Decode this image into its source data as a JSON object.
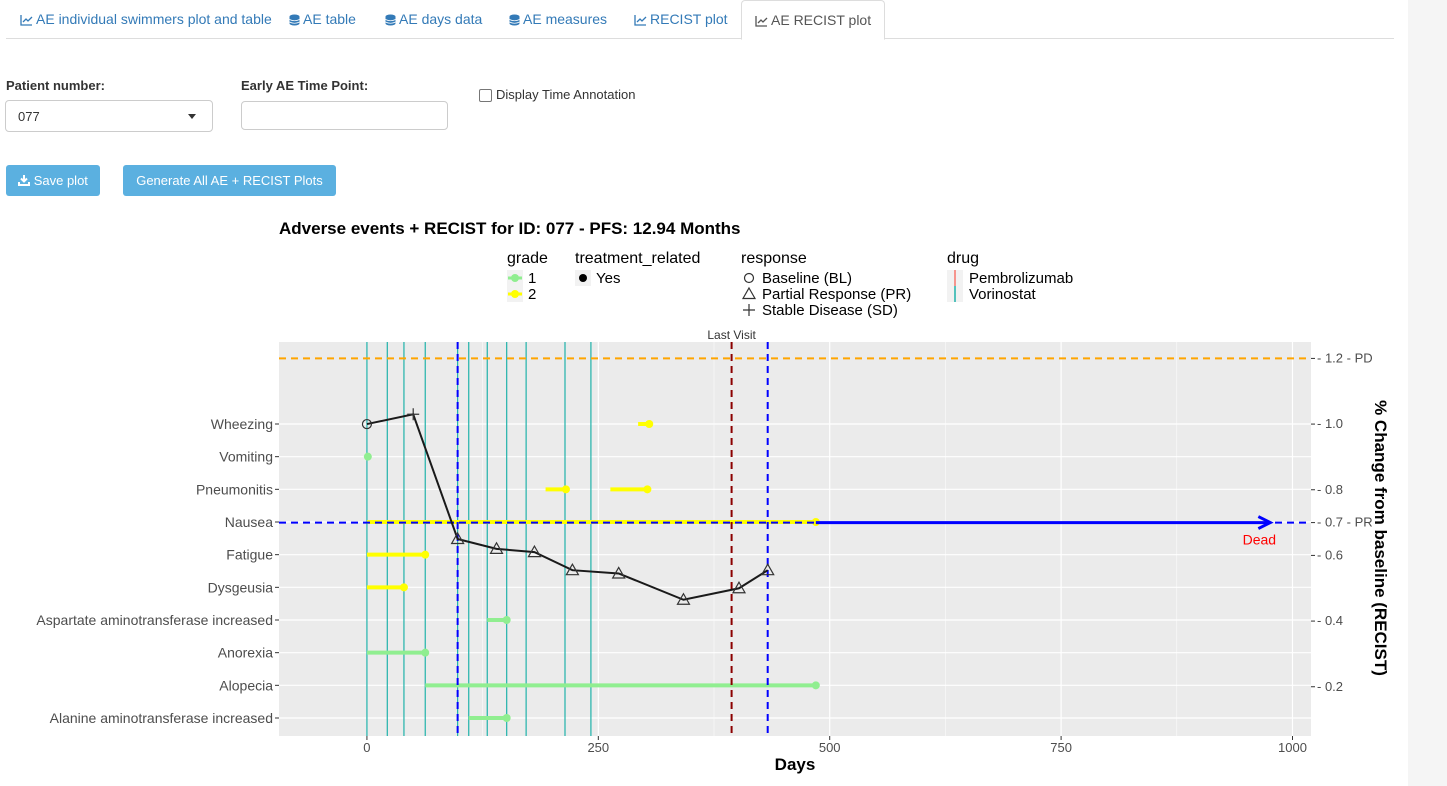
{
  "tabs": [
    {
      "label": "AE individual swimmers plot and table",
      "icon": "line-chart-icon"
    },
    {
      "label": "AE table",
      "icon": "database-icon"
    },
    {
      "label": "AE days data",
      "icon": "database-icon"
    },
    {
      "label": "AE measures",
      "icon": "database-icon"
    },
    {
      "label": "RECIST plot",
      "icon": "line-chart-icon"
    },
    {
      "label": "AE RECIST plot",
      "icon": "line-chart-icon",
      "active": true
    }
  ],
  "controls": {
    "patient_label": "Patient number:",
    "patient_value": "077",
    "early_ae_label": "Early AE Time Point:",
    "early_ae_value": "",
    "display_time_annotation_label": "Display Time Annotation",
    "display_time_annotation_checked": false,
    "save_plot_label": "Save plot",
    "generate_all_label": "Generate All AE + RECIST Plots"
  },
  "chart_data": {
    "type": "line",
    "title": "Adverse events + RECIST for ID: 077 - PFS: 12.94 Months",
    "xlabel": "Days",
    "ylabel_right": "% Change from baseline (RECIST)",
    "xlim": [
      -95,
      1020
    ],
    "x_ticks": [
      0,
      250,
      500,
      750,
      1000
    ],
    "ylim_right": [
      0.05,
      1.25
    ],
    "y_right_ticks": [
      {
        "value": 0.2,
        "label": "0.2"
      },
      {
        "value": 0.4,
        "label": "0.4"
      },
      {
        "value": 0.6,
        "label": "0.6"
      },
      {
        "value": 0.7,
        "label": "0.7 - PR"
      },
      {
        "value": 0.8,
        "label": "0.8"
      },
      {
        "value": 1.0,
        "label": "1.0"
      },
      {
        "value": 1.2,
        "label": "1.2 - PD"
      }
    ],
    "ae_categories": [
      "Wheezing",
      "Vomiting",
      "Pneumonitis",
      "Nausea",
      "Fatigue",
      "Dysgeusia",
      "Aspartate aminotransferase increased",
      "Anorexia",
      "Alopecia",
      "Alanine aminotransferase increased"
    ],
    "ae_segments": [
      {
        "ae": "Wheezing",
        "start": 293,
        "end": 305,
        "grade": 2
      },
      {
        "ae": "Vomiting",
        "start": 0,
        "end": 1,
        "grade": 1
      },
      {
        "ae": "Pneumonitis",
        "start": 193,
        "end": 215,
        "grade": 2
      },
      {
        "ae": "Pneumonitis",
        "start": 263,
        "end": 303,
        "grade": 2
      },
      {
        "ae": "Nausea",
        "start": 0,
        "end": 485,
        "grade": 2
      },
      {
        "ae": "Fatigue",
        "start": 0,
        "end": 63,
        "grade": 2
      },
      {
        "ae": "Dysgeusia",
        "start": 0,
        "end": 40,
        "grade": 2
      },
      {
        "ae": "Aspartate aminotransferase increased",
        "start": 130,
        "end": 151,
        "grade": 1
      },
      {
        "ae": "Anorexia",
        "start": 0,
        "end": 63,
        "grade": 1
      },
      {
        "ae": "Alopecia",
        "start": 63,
        "end": 485,
        "grade": 1
      },
      {
        "ae": "Alanine aminotransferase increased",
        "start": 110,
        "end": 151,
        "grade": 1
      }
    ],
    "recist_series": {
      "x": [
        0,
        50,
        98,
        140,
        181,
        222,
        272,
        342,
        402,
        433
      ],
      "y": [
        1.0,
        1.03,
        0.65,
        0.62,
        0.61,
        0.555,
        0.545,
        0.465,
        0.5,
        0.555
      ],
      "response": [
        "BL",
        "SD",
        "PR",
        "PR",
        "PR",
        "PR",
        "PR",
        "PR",
        "PR",
        "PR"
      ]
    },
    "drug_lines": {
      "Vorinostat": [
        0,
        22,
        40,
        63,
        98,
        110,
        130,
        151,
        172,
        214,
        242
      ],
      "Pembrolizumab": []
    },
    "pd_threshold": 1.2,
    "pr_threshold": 0.7,
    "blue_dashed_days": [
      98,
      433
    ],
    "last_visit_day": 394,
    "last_visit_label": "Last Visit",
    "death_arrow": {
      "start": 485,
      "end": 975,
      "y": 0.7,
      "label": "Dead"
    },
    "colors": {
      "grade1": "#90ee90",
      "grade2": "#ffff00",
      "vorinostat": "#20b2aa",
      "pembrolizumab": "#f8766d",
      "pd_line": "#ffa500",
      "blue": "#0000ff",
      "last_visit": "#8b0000",
      "dead_text": "#ff0000",
      "panel_bg": "#ebebeb"
    },
    "legend": {
      "grade": {
        "title": "grade",
        "items": [
          "1",
          "2"
        ]
      },
      "treatment_related": {
        "title": "treatment_related",
        "items": [
          "Yes"
        ]
      },
      "response": {
        "title": "response",
        "items": [
          "Baseline (BL)",
          "Partial Response (PR)",
          "Stable Disease (SD)"
        ]
      },
      "drug": {
        "title": "drug",
        "items": [
          "Pembrolizumab",
          "Vorinostat"
        ]
      }
    }
  }
}
